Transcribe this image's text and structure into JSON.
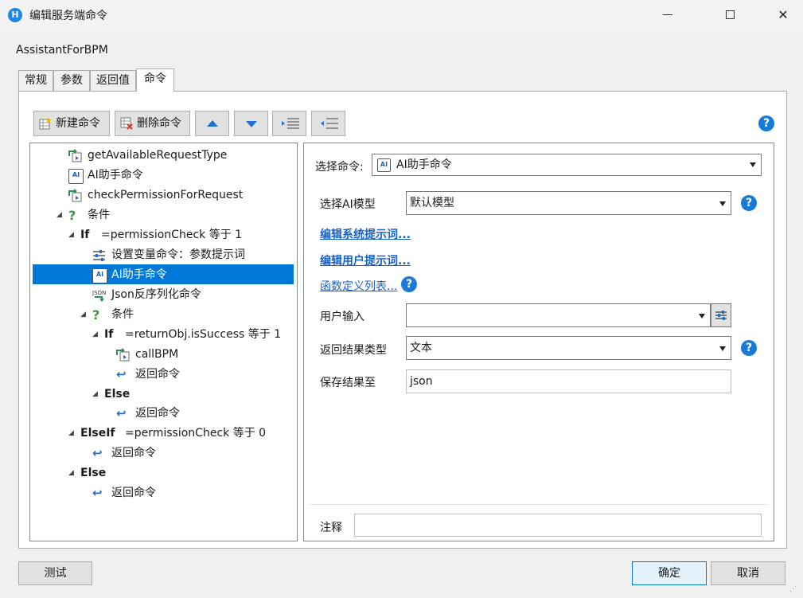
{
  "window": {
    "title": "编辑服务端命令",
    "icon_label": "H"
  },
  "subtitle": "AssistantForBPM",
  "tabs": [
    {
      "label": "常规"
    },
    {
      "label": "参数"
    },
    {
      "label": "返回值"
    },
    {
      "label": "命令"
    }
  ],
  "toolbar": {
    "new_label": "新建命令",
    "delete_label": "删除命令"
  },
  "tree": {
    "nodes": [
      {
        "text": "getAvailableRequestType"
      },
      {
        "text": "AI助手命令"
      },
      {
        "text": "checkPermissionForRequest"
      },
      {
        "text": "条件"
      },
      {
        "kw": "If",
        "text": "=permissionCheck 等于 1"
      },
      {
        "text": "设置变量命令：参数提示词"
      },
      {
        "text": "AI助手命令"
      },
      {
        "text": "Json反序列化命令"
      },
      {
        "text": "条件"
      },
      {
        "kw": "If",
        "text": "=returnObj.isSuccess 等于 1"
      },
      {
        "text": "callBPM"
      },
      {
        "text": "返回命令"
      },
      {
        "kw": "Else",
        "text": ""
      },
      {
        "text": "返回命令"
      },
      {
        "kw": "ElseIf",
        "text": "=permissionCheck 等于 0"
      },
      {
        "text": "返回命令"
      },
      {
        "kw": "Else",
        "text": ""
      },
      {
        "text": "返回命令"
      }
    ]
  },
  "detail": {
    "select_command_label": "选择命令:",
    "select_command_value": "AI助手命令",
    "ai_model_label": "选择AI模型",
    "ai_model_value": "默认模型",
    "edit_system_prompt": "编辑系统提示词...",
    "edit_user_prompt": "编辑用户提示词...",
    "function_list": "函数定义列表...",
    "user_input_label": "用户输入",
    "user_input_value": "",
    "result_type_label": "返回结果类型",
    "result_type_value": "文本",
    "save_result_label": "保存结果至",
    "save_result_value": "json",
    "comment_label": "注释",
    "comment_value": ""
  },
  "buttons": {
    "test": "测试",
    "ok": "确定",
    "cancel": "取消"
  },
  "colors": {
    "accent": "#0078d7",
    "link": "#1a62c4",
    "help": "#1a7ad9"
  }
}
